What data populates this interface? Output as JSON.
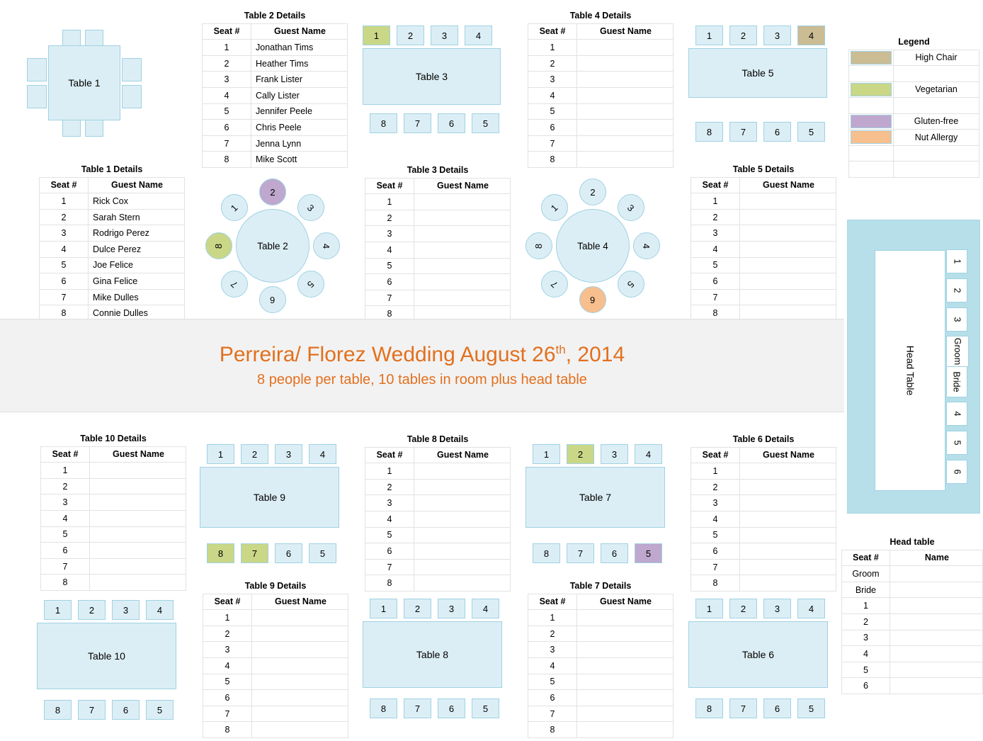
{
  "title": {
    "main_prefix": "Perreira/ Florez Wedding August 26",
    "main_sup": "th",
    "main_suffix": ", 2014",
    "subtitle": "8 people per table, 10 tables in room plus head table"
  },
  "legend": {
    "title": "Legend",
    "items": [
      {
        "label": "High Chair",
        "color": "#cbbc94"
      },
      {
        "label": "Vegetarian",
        "color": "#c9d787"
      },
      {
        "label": "Gluten-free",
        "color": "#bfa7cd"
      },
      {
        "label": "Nut Allergy",
        "color": "#f7bf8d"
      }
    ]
  },
  "details_headers": {
    "seat": "Seat #",
    "name": "Guest Name"
  },
  "head_table_details": {
    "title": "Head table",
    "headers": {
      "seat": "Seat #",
      "name": "Name"
    },
    "rows": [
      {
        "seat": "Groom",
        "name": ""
      },
      {
        "seat": "Bride",
        "name": ""
      },
      {
        "seat": "1",
        "name": ""
      },
      {
        "seat": "2",
        "name": ""
      },
      {
        "seat": "3",
        "name": ""
      },
      {
        "seat": "4",
        "name": ""
      },
      {
        "seat": "5",
        "name": ""
      },
      {
        "seat": "6",
        "name": ""
      }
    ]
  },
  "head_table_diagram": {
    "label": "Head Table",
    "chairs": [
      "1",
      "2",
      "3",
      "Groom",
      "Bride",
      "4",
      "5",
      "6"
    ]
  },
  "tables": {
    "t1": {
      "label": "Table 1",
      "details_title": "Table 1 Details",
      "rows": [
        {
          "seat": "1",
          "name": "Rick Cox"
        },
        {
          "seat": "2",
          "name": "Sarah Stern"
        },
        {
          "seat": "3",
          "name": "Rodrigo Perez"
        },
        {
          "seat": "4",
          "name": "Dulce Perez"
        },
        {
          "seat": "5",
          "name": "Joe Felice"
        },
        {
          "seat": "6",
          "name": "Gina Felice"
        },
        {
          "seat": "7",
          "name": "Mike Dulles"
        },
        {
          "seat": "8",
          "name": "Connie Dulles"
        }
      ]
    },
    "t2": {
      "label": "Table 2",
      "details_title": "Table 2 Details",
      "rows": [
        {
          "seat": "1",
          "name": "Jonathan Tims"
        },
        {
          "seat": "2",
          "name": "Heather Tims"
        },
        {
          "seat": "3",
          "name": "Frank Lister"
        },
        {
          "seat": "4",
          "name": "Cally Lister"
        },
        {
          "seat": "5",
          "name": "Jennifer Peele"
        },
        {
          "seat": "6",
          "name": "Chris Peele"
        },
        {
          "seat": "7",
          "name": "Jenna  Lynn"
        },
        {
          "seat": "8",
          "name": "Mike Scott"
        }
      ],
      "seats": [
        {
          "num": "1",
          "diet": ""
        },
        {
          "num": "2",
          "diet": "gf"
        },
        {
          "num": "3",
          "diet": ""
        },
        {
          "num": "4",
          "diet": ""
        },
        {
          "num": "5",
          "diet": ""
        },
        {
          "num": "6",
          "diet": ""
        },
        {
          "num": "7",
          "diet": ""
        },
        {
          "num": "8",
          "diet": "veg"
        }
      ]
    },
    "t3": {
      "label": "Table 3",
      "details_title": "Table 3 Details",
      "rows": [
        {
          "seat": "1",
          "name": ""
        },
        {
          "seat": "2",
          "name": ""
        },
        {
          "seat": "3",
          "name": ""
        },
        {
          "seat": "4",
          "name": ""
        },
        {
          "seat": "5",
          "name": ""
        },
        {
          "seat": "6",
          "name": ""
        },
        {
          "seat": "7",
          "name": ""
        },
        {
          "seat": "8",
          "name": ""
        }
      ],
      "top_chairs": [
        {
          "num": "1",
          "diet": "veg"
        },
        {
          "num": "2",
          "diet": ""
        },
        {
          "num": "3",
          "diet": ""
        },
        {
          "num": "4",
          "diet": ""
        }
      ],
      "bottom_chairs": [
        {
          "num": "8",
          "diet": ""
        },
        {
          "num": "7",
          "diet": ""
        },
        {
          "num": "6",
          "diet": ""
        },
        {
          "num": "5",
          "diet": ""
        }
      ]
    },
    "t4": {
      "label": "Table 4",
      "details_title": "Table 4 Details",
      "rows": [
        {
          "seat": "1",
          "name": ""
        },
        {
          "seat": "2",
          "name": ""
        },
        {
          "seat": "3",
          "name": ""
        },
        {
          "seat": "4",
          "name": ""
        },
        {
          "seat": "5",
          "name": ""
        },
        {
          "seat": "6",
          "name": ""
        },
        {
          "seat": "7",
          "name": ""
        },
        {
          "seat": "8",
          "name": ""
        }
      ],
      "seats": [
        {
          "num": "1",
          "diet": ""
        },
        {
          "num": "2",
          "diet": ""
        },
        {
          "num": "3",
          "diet": ""
        },
        {
          "num": "4",
          "diet": ""
        },
        {
          "num": "5",
          "diet": ""
        },
        {
          "num": "6",
          "diet": "nut"
        },
        {
          "num": "7",
          "diet": ""
        },
        {
          "num": "8",
          "diet": ""
        }
      ]
    },
    "t5": {
      "label": "Table 5",
      "details_title": "Table 5 Details",
      "rows": [
        {
          "seat": "1",
          "name": ""
        },
        {
          "seat": "2",
          "name": ""
        },
        {
          "seat": "3",
          "name": ""
        },
        {
          "seat": "4",
          "name": ""
        },
        {
          "seat": "5",
          "name": ""
        },
        {
          "seat": "6",
          "name": ""
        },
        {
          "seat": "7",
          "name": ""
        },
        {
          "seat": "8",
          "name": ""
        }
      ],
      "top_chairs": [
        {
          "num": "1",
          "diet": ""
        },
        {
          "num": "2",
          "diet": ""
        },
        {
          "num": "3",
          "diet": ""
        },
        {
          "num": "4",
          "diet": "high"
        }
      ],
      "bottom_chairs": [
        {
          "num": "8",
          "diet": ""
        },
        {
          "num": "7",
          "diet": ""
        },
        {
          "num": "6",
          "diet": ""
        },
        {
          "num": "5",
          "diet": ""
        }
      ]
    },
    "t6": {
      "label": "Table 6",
      "details_title": "Table 6 Details",
      "rows": [
        {
          "seat": "1",
          "name": ""
        },
        {
          "seat": "2",
          "name": ""
        },
        {
          "seat": "3",
          "name": ""
        },
        {
          "seat": "4",
          "name": ""
        },
        {
          "seat": "5",
          "name": ""
        },
        {
          "seat": "6",
          "name": ""
        },
        {
          "seat": "7",
          "name": ""
        },
        {
          "seat": "8",
          "name": ""
        }
      ],
      "top_chairs": [
        {
          "num": "1",
          "diet": ""
        },
        {
          "num": "2",
          "diet": ""
        },
        {
          "num": "3",
          "diet": ""
        },
        {
          "num": "4",
          "diet": ""
        }
      ],
      "bottom_chairs": [
        {
          "num": "8",
          "diet": ""
        },
        {
          "num": "7",
          "diet": ""
        },
        {
          "num": "6",
          "diet": ""
        },
        {
          "num": "5",
          "diet": ""
        }
      ]
    },
    "t7": {
      "label": "Table 7",
      "details_title": "Table 7 Details",
      "rows": [
        {
          "seat": "1",
          "name": ""
        },
        {
          "seat": "2",
          "name": ""
        },
        {
          "seat": "3",
          "name": ""
        },
        {
          "seat": "4",
          "name": ""
        },
        {
          "seat": "5",
          "name": ""
        },
        {
          "seat": "6",
          "name": ""
        },
        {
          "seat": "7",
          "name": ""
        },
        {
          "seat": "8",
          "name": ""
        }
      ],
      "top_chairs": [
        {
          "num": "1",
          "diet": ""
        },
        {
          "num": "2",
          "diet": "veg"
        },
        {
          "num": "3",
          "diet": ""
        },
        {
          "num": "4",
          "diet": ""
        }
      ],
      "bottom_chairs": [
        {
          "num": "8",
          "diet": ""
        },
        {
          "num": "7",
          "diet": ""
        },
        {
          "num": "6",
          "diet": ""
        },
        {
          "num": "5",
          "diet": "gf"
        }
      ]
    },
    "t8": {
      "label": "Table 8",
      "details_title": "Table 8 Details",
      "rows": [
        {
          "seat": "1",
          "name": ""
        },
        {
          "seat": "2",
          "name": ""
        },
        {
          "seat": "3",
          "name": ""
        },
        {
          "seat": "4",
          "name": ""
        },
        {
          "seat": "5",
          "name": ""
        },
        {
          "seat": "6",
          "name": ""
        },
        {
          "seat": "7",
          "name": ""
        },
        {
          "seat": "8",
          "name": ""
        }
      ],
      "top_chairs": [
        {
          "num": "1",
          "diet": ""
        },
        {
          "num": "2",
          "diet": ""
        },
        {
          "num": "3",
          "diet": ""
        },
        {
          "num": "4",
          "diet": ""
        }
      ],
      "bottom_chairs": [
        {
          "num": "8",
          "diet": ""
        },
        {
          "num": "7",
          "diet": ""
        },
        {
          "num": "6",
          "diet": ""
        },
        {
          "num": "5",
          "diet": ""
        }
      ]
    },
    "t9": {
      "label": "Table 9",
      "details_title": "Table 9 Details",
      "rows": [
        {
          "seat": "1",
          "name": ""
        },
        {
          "seat": "2",
          "name": ""
        },
        {
          "seat": "3",
          "name": ""
        },
        {
          "seat": "4",
          "name": ""
        },
        {
          "seat": "5",
          "name": ""
        },
        {
          "seat": "6",
          "name": ""
        },
        {
          "seat": "7",
          "name": ""
        },
        {
          "seat": "8",
          "name": ""
        }
      ],
      "top_chairs": [
        {
          "num": "1",
          "diet": ""
        },
        {
          "num": "2",
          "diet": ""
        },
        {
          "num": "3",
          "diet": ""
        },
        {
          "num": "4",
          "diet": ""
        }
      ],
      "bottom_chairs": [
        {
          "num": "8",
          "diet": "veg"
        },
        {
          "num": "7",
          "diet": "veg"
        },
        {
          "num": "6",
          "diet": ""
        },
        {
          "num": "5",
          "diet": ""
        }
      ]
    },
    "t10": {
      "label": "Table 10",
      "details_title": "Table 10 Details",
      "rows": [
        {
          "seat": "1",
          "name": ""
        },
        {
          "seat": "2",
          "name": ""
        },
        {
          "seat": "3",
          "name": ""
        },
        {
          "seat": "4",
          "name": ""
        },
        {
          "seat": "5",
          "name": ""
        },
        {
          "seat": "6",
          "name": ""
        },
        {
          "seat": "7",
          "name": ""
        },
        {
          "seat": "8",
          "name": ""
        }
      ],
      "top_chairs": [
        {
          "num": "1",
          "diet": ""
        },
        {
          "num": "2",
          "diet": ""
        },
        {
          "num": "3",
          "diet": ""
        },
        {
          "num": "4",
          "diet": ""
        }
      ],
      "bottom_chairs": [
        {
          "num": "8",
          "diet": ""
        },
        {
          "num": "7",
          "diet": ""
        },
        {
          "num": "6",
          "diet": ""
        },
        {
          "num": "5",
          "diet": ""
        }
      ]
    }
  }
}
